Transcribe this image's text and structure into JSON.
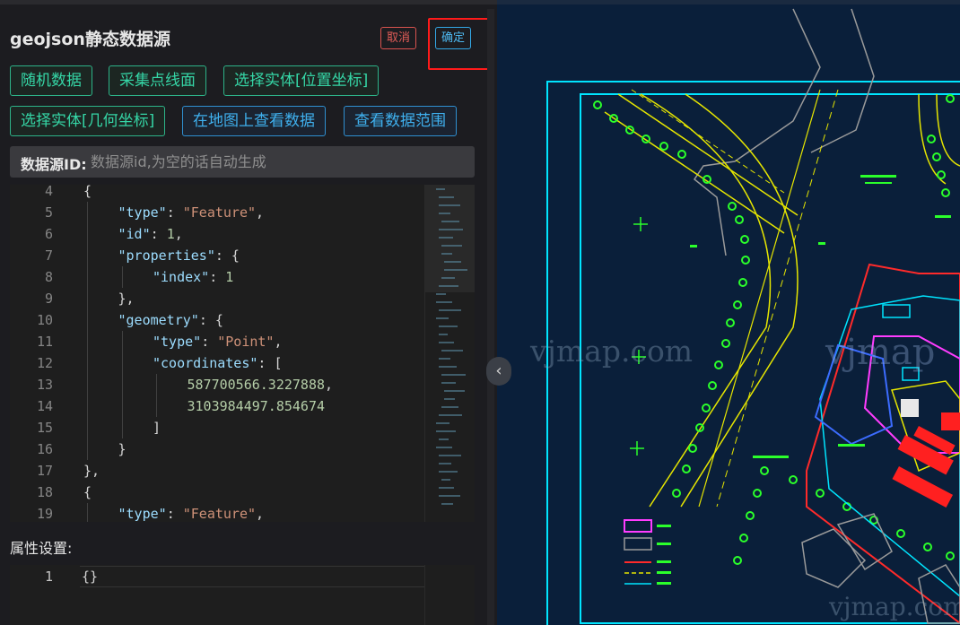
{
  "panel": {
    "title": "geojson静态数据源",
    "cancel_label": "取消",
    "ok_label": "确定",
    "tools": {
      "random_data": "随机数据",
      "collect": "采集点线面",
      "select_entity_pos": "选择实体[位置坐标]",
      "select_entity_geo": "选择实体[几何坐标]",
      "view_on_map": "在地图上查看数据",
      "view_range": "查看数据范围"
    },
    "datasource_id_label": "数据源ID:",
    "datasource_id_placeholder": "数据源id,为空的话自动生成",
    "attr_settings_label": "属性设置:"
  },
  "editor": {
    "lines": [
      {
        "no": "4",
        "indent": 2,
        "parts": [
          {
            "t": "p",
            "v": "{"
          }
        ]
      },
      {
        "no": "5",
        "indent": 3,
        "parts": [
          {
            "t": "k",
            "v": "\"type\""
          },
          {
            "t": "p",
            "v": ": "
          },
          {
            "t": "s",
            "v": "\"Feature\""
          },
          {
            "t": "p",
            "v": ","
          }
        ]
      },
      {
        "no": "6",
        "indent": 3,
        "parts": [
          {
            "t": "k",
            "v": "\"id\""
          },
          {
            "t": "p",
            "v": ": "
          },
          {
            "t": "n",
            "v": "1"
          },
          {
            "t": "p",
            "v": ","
          }
        ]
      },
      {
        "no": "7",
        "indent": 3,
        "parts": [
          {
            "t": "k",
            "v": "\"properties\""
          },
          {
            "t": "p",
            "v": ": {"
          }
        ]
      },
      {
        "no": "8",
        "indent": 4,
        "parts": [
          {
            "t": "k",
            "v": "\"index\""
          },
          {
            "t": "p",
            "v": ": "
          },
          {
            "t": "n",
            "v": "1"
          }
        ]
      },
      {
        "no": "9",
        "indent": 3,
        "parts": [
          {
            "t": "p",
            "v": "},"
          }
        ]
      },
      {
        "no": "10",
        "indent": 3,
        "parts": [
          {
            "t": "k",
            "v": "\"geometry\""
          },
          {
            "t": "p",
            "v": ": {"
          }
        ]
      },
      {
        "no": "11",
        "indent": 4,
        "parts": [
          {
            "t": "k",
            "v": "\"type\""
          },
          {
            "t": "p",
            "v": ": "
          },
          {
            "t": "s",
            "v": "\"Point\""
          },
          {
            "t": "p",
            "v": ","
          }
        ]
      },
      {
        "no": "12",
        "indent": 4,
        "parts": [
          {
            "t": "k",
            "v": "\"coordinates\""
          },
          {
            "t": "p",
            "v": ": ["
          }
        ]
      },
      {
        "no": "13",
        "indent": 5,
        "parts": [
          {
            "t": "n",
            "v": "587700566.3227888"
          },
          {
            "t": "p",
            "v": ","
          }
        ]
      },
      {
        "no": "14",
        "indent": 5,
        "parts": [
          {
            "t": "n",
            "v": "3103984497.854674"
          }
        ]
      },
      {
        "no": "15",
        "indent": 4,
        "parts": [
          {
            "t": "p",
            "v": "]"
          }
        ]
      },
      {
        "no": "16",
        "indent": 3,
        "parts": [
          {
            "t": "p",
            "v": "}"
          }
        ]
      },
      {
        "no": "17",
        "indent": 2,
        "parts": [
          {
            "t": "p",
            "v": "},"
          }
        ]
      },
      {
        "no": "18",
        "indent": 2,
        "parts": [
          {
            "t": "p",
            "v": "{"
          }
        ]
      },
      {
        "no": "19",
        "indent": 3,
        "parts": [
          {
            "t": "k",
            "v": "\"type\""
          },
          {
            "t": "p",
            "v": ": "
          },
          {
            "t": "s",
            "v": "\"Feature\""
          },
          {
            "t": "p",
            "v": ","
          }
        ]
      }
    ]
  },
  "editor2": {
    "line_no": "1",
    "code": "{}"
  },
  "map": {
    "watermark": "vjmap.com",
    "watermark2": "vjmap",
    "collapse_icon": "chevron-left-icon",
    "collapse_glyph": "‹"
  },
  "colors": {
    "map_bg": "#0a1f3a",
    "cad_cyan": "#00e5ff",
    "cad_yellow": "#e6e600",
    "cad_green": "#2bff2b",
    "cad_red": "#ff2a2a",
    "cad_magenta": "#ff3cff",
    "tool_green": "#35d6a6",
    "tool_blue": "#3fb0ee"
  }
}
